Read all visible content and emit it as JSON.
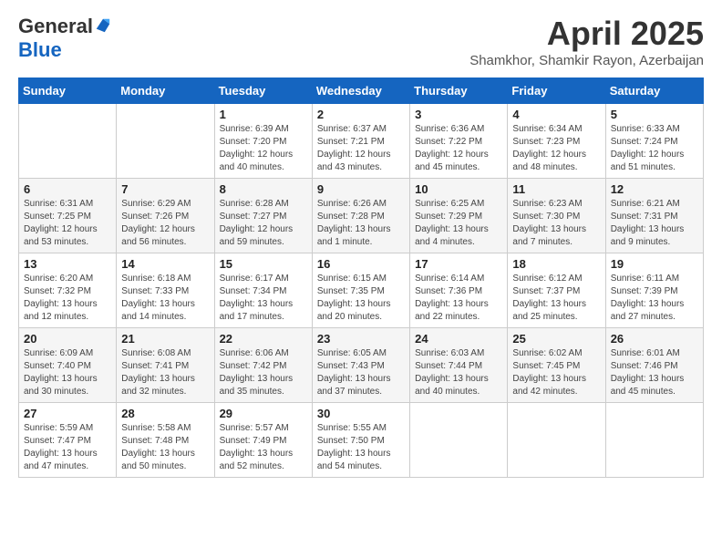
{
  "header": {
    "logo_general": "General",
    "logo_blue": "Blue",
    "month_title": "April 2025",
    "location": "Shamkhor, Shamkir Rayon, Azerbaijan"
  },
  "days_of_week": [
    "Sunday",
    "Monday",
    "Tuesday",
    "Wednesday",
    "Thursday",
    "Friday",
    "Saturday"
  ],
  "weeks": [
    [
      {
        "day": "",
        "sunrise": "",
        "sunset": "",
        "daylight": ""
      },
      {
        "day": "",
        "sunrise": "",
        "sunset": "",
        "daylight": ""
      },
      {
        "day": "1",
        "sunrise": "Sunrise: 6:39 AM",
        "sunset": "Sunset: 7:20 PM",
        "daylight": "Daylight: 12 hours and 40 minutes."
      },
      {
        "day": "2",
        "sunrise": "Sunrise: 6:37 AM",
        "sunset": "Sunset: 7:21 PM",
        "daylight": "Daylight: 12 hours and 43 minutes."
      },
      {
        "day": "3",
        "sunrise": "Sunrise: 6:36 AM",
        "sunset": "Sunset: 7:22 PM",
        "daylight": "Daylight: 12 hours and 45 minutes."
      },
      {
        "day": "4",
        "sunrise": "Sunrise: 6:34 AM",
        "sunset": "Sunset: 7:23 PM",
        "daylight": "Daylight: 12 hours and 48 minutes."
      },
      {
        "day": "5",
        "sunrise": "Sunrise: 6:33 AM",
        "sunset": "Sunset: 7:24 PM",
        "daylight": "Daylight: 12 hours and 51 minutes."
      }
    ],
    [
      {
        "day": "6",
        "sunrise": "Sunrise: 6:31 AM",
        "sunset": "Sunset: 7:25 PM",
        "daylight": "Daylight: 12 hours and 53 minutes."
      },
      {
        "day": "7",
        "sunrise": "Sunrise: 6:29 AM",
        "sunset": "Sunset: 7:26 PM",
        "daylight": "Daylight: 12 hours and 56 minutes."
      },
      {
        "day": "8",
        "sunrise": "Sunrise: 6:28 AM",
        "sunset": "Sunset: 7:27 PM",
        "daylight": "Daylight: 12 hours and 59 minutes."
      },
      {
        "day": "9",
        "sunrise": "Sunrise: 6:26 AM",
        "sunset": "Sunset: 7:28 PM",
        "daylight": "Daylight: 13 hours and 1 minute."
      },
      {
        "day": "10",
        "sunrise": "Sunrise: 6:25 AM",
        "sunset": "Sunset: 7:29 PM",
        "daylight": "Daylight: 13 hours and 4 minutes."
      },
      {
        "day": "11",
        "sunrise": "Sunrise: 6:23 AM",
        "sunset": "Sunset: 7:30 PM",
        "daylight": "Daylight: 13 hours and 7 minutes."
      },
      {
        "day": "12",
        "sunrise": "Sunrise: 6:21 AM",
        "sunset": "Sunset: 7:31 PM",
        "daylight": "Daylight: 13 hours and 9 minutes."
      }
    ],
    [
      {
        "day": "13",
        "sunrise": "Sunrise: 6:20 AM",
        "sunset": "Sunset: 7:32 PM",
        "daylight": "Daylight: 13 hours and 12 minutes."
      },
      {
        "day": "14",
        "sunrise": "Sunrise: 6:18 AM",
        "sunset": "Sunset: 7:33 PM",
        "daylight": "Daylight: 13 hours and 14 minutes."
      },
      {
        "day": "15",
        "sunrise": "Sunrise: 6:17 AM",
        "sunset": "Sunset: 7:34 PM",
        "daylight": "Daylight: 13 hours and 17 minutes."
      },
      {
        "day": "16",
        "sunrise": "Sunrise: 6:15 AM",
        "sunset": "Sunset: 7:35 PM",
        "daylight": "Daylight: 13 hours and 20 minutes."
      },
      {
        "day": "17",
        "sunrise": "Sunrise: 6:14 AM",
        "sunset": "Sunset: 7:36 PM",
        "daylight": "Daylight: 13 hours and 22 minutes."
      },
      {
        "day": "18",
        "sunrise": "Sunrise: 6:12 AM",
        "sunset": "Sunset: 7:37 PM",
        "daylight": "Daylight: 13 hours and 25 minutes."
      },
      {
        "day": "19",
        "sunrise": "Sunrise: 6:11 AM",
        "sunset": "Sunset: 7:39 PM",
        "daylight": "Daylight: 13 hours and 27 minutes."
      }
    ],
    [
      {
        "day": "20",
        "sunrise": "Sunrise: 6:09 AM",
        "sunset": "Sunset: 7:40 PM",
        "daylight": "Daylight: 13 hours and 30 minutes."
      },
      {
        "day": "21",
        "sunrise": "Sunrise: 6:08 AM",
        "sunset": "Sunset: 7:41 PM",
        "daylight": "Daylight: 13 hours and 32 minutes."
      },
      {
        "day": "22",
        "sunrise": "Sunrise: 6:06 AM",
        "sunset": "Sunset: 7:42 PM",
        "daylight": "Daylight: 13 hours and 35 minutes."
      },
      {
        "day": "23",
        "sunrise": "Sunrise: 6:05 AM",
        "sunset": "Sunset: 7:43 PM",
        "daylight": "Daylight: 13 hours and 37 minutes."
      },
      {
        "day": "24",
        "sunrise": "Sunrise: 6:03 AM",
        "sunset": "Sunset: 7:44 PM",
        "daylight": "Daylight: 13 hours and 40 minutes."
      },
      {
        "day": "25",
        "sunrise": "Sunrise: 6:02 AM",
        "sunset": "Sunset: 7:45 PM",
        "daylight": "Daylight: 13 hours and 42 minutes."
      },
      {
        "day": "26",
        "sunrise": "Sunrise: 6:01 AM",
        "sunset": "Sunset: 7:46 PM",
        "daylight": "Daylight: 13 hours and 45 minutes."
      }
    ],
    [
      {
        "day": "27",
        "sunrise": "Sunrise: 5:59 AM",
        "sunset": "Sunset: 7:47 PM",
        "daylight": "Daylight: 13 hours and 47 minutes."
      },
      {
        "day": "28",
        "sunrise": "Sunrise: 5:58 AM",
        "sunset": "Sunset: 7:48 PM",
        "daylight": "Daylight: 13 hours and 50 minutes."
      },
      {
        "day": "29",
        "sunrise": "Sunrise: 5:57 AM",
        "sunset": "Sunset: 7:49 PM",
        "daylight": "Daylight: 13 hours and 52 minutes."
      },
      {
        "day": "30",
        "sunrise": "Sunrise: 5:55 AM",
        "sunset": "Sunset: 7:50 PM",
        "daylight": "Daylight: 13 hours and 54 minutes."
      },
      {
        "day": "",
        "sunrise": "",
        "sunset": "",
        "daylight": ""
      },
      {
        "day": "",
        "sunrise": "",
        "sunset": "",
        "daylight": ""
      },
      {
        "day": "",
        "sunrise": "",
        "sunset": "",
        "daylight": ""
      }
    ]
  ]
}
